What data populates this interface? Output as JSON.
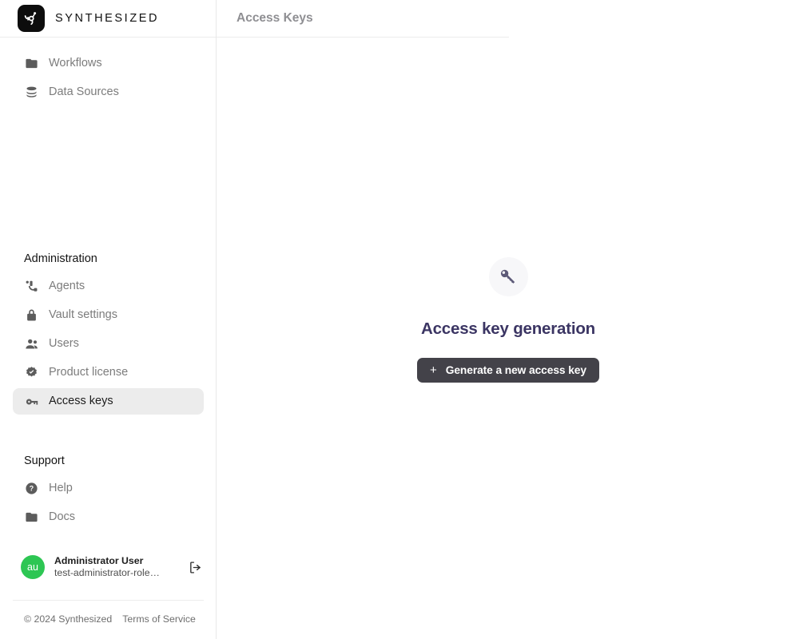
{
  "brand": {
    "name": "SYNTHESIZED",
    "logo_icon": "synthesized-node-graph-icon"
  },
  "sidebar": {
    "primary_nav": [
      {
        "label": "Workflows",
        "icon": "folder-icon",
        "active": false
      },
      {
        "label": "Data Sources",
        "icon": "database-icon",
        "active": false
      }
    ],
    "administration": {
      "heading": "Administration",
      "items": [
        {
          "label": "Agents",
          "icon": "agents-hub-icon",
          "active": false
        },
        {
          "label": "Vault settings",
          "icon": "lock-icon",
          "active": false
        },
        {
          "label": "Users",
          "icon": "users-icon",
          "active": false
        },
        {
          "label": "Product license",
          "icon": "verified-badge-icon",
          "active": false
        },
        {
          "label": "Access keys",
          "icon": "key-icon",
          "active": true
        }
      ]
    },
    "support": {
      "heading": "Support",
      "items": [
        {
          "label": "Help",
          "icon": "help-circle-icon",
          "active": false
        },
        {
          "label": "Docs",
          "icon": "folder-icon",
          "active": false
        }
      ]
    },
    "user": {
      "avatar_initials": "au",
      "avatar_color": "#2dc653",
      "name": "Administrator User",
      "role": "test-administrator-role…",
      "logout_icon": "logout-icon"
    },
    "footer": {
      "copyright": "© 2024 Synthesized",
      "terms_label": "Terms of Service"
    }
  },
  "header": {
    "title": "Access Keys"
  },
  "main": {
    "empty_state": {
      "icon": "key-icon",
      "title": "Access key generation",
      "button_label": "Generate a new access key",
      "button_plus": "+"
    }
  },
  "colors": {
    "accent_button": "#434249",
    "title_indigo": "#3b3563",
    "avatar_green": "#2dc653",
    "active_nav_bg": "#ececec",
    "key_icon": "#5d5a78"
  }
}
